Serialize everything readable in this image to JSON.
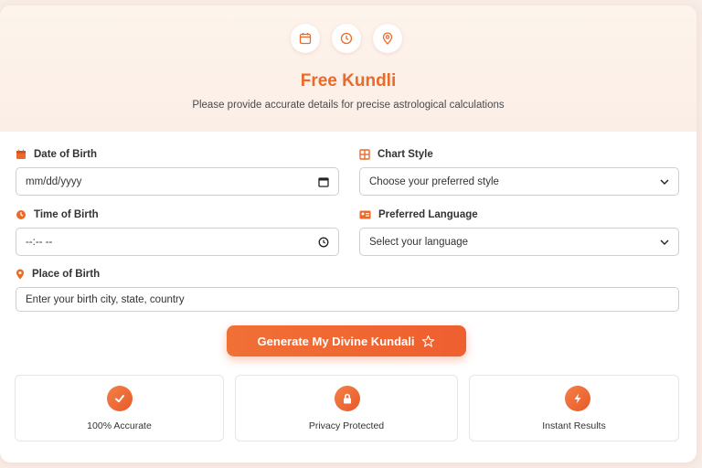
{
  "header": {
    "icons": [
      "calendar-icon",
      "clock-icon",
      "map-pin-icon"
    ],
    "title": "Free Kundli",
    "subtitle": "Please provide accurate details for precise astrological calculations"
  },
  "form": {
    "date_of_birth": {
      "label": "Date of Birth",
      "placeholder": "mm/dd/yyyy",
      "icon": "calendar-icon"
    },
    "time_of_birth": {
      "label": "Time of Birth",
      "placeholder": "--:-- --",
      "icon": "clock-icon"
    },
    "place_of_birth": {
      "label": "Place of Birth",
      "placeholder": "Enter your birth city, state, country",
      "icon": "map-pin-icon"
    },
    "chart_style": {
      "label": "Chart Style",
      "selected": "Choose your preferred style",
      "icon": "grid-icon"
    },
    "preferred_language": {
      "label": "Preferred Language",
      "selected": "Select your language",
      "icon": "id-card-icon"
    }
  },
  "cta": {
    "label": "Generate My Divine Kundali",
    "icon": "star-icon"
  },
  "features": [
    {
      "label": "100% Accurate",
      "icon": "check-icon"
    },
    {
      "label": "Privacy Protected",
      "icon": "lock-icon"
    },
    {
      "label": "Instant Results",
      "icon": "lightning-icon"
    }
  ],
  "colors": {
    "accent": "#ea6a2a",
    "background": "#f7ece6",
    "card": "#ffffff"
  }
}
